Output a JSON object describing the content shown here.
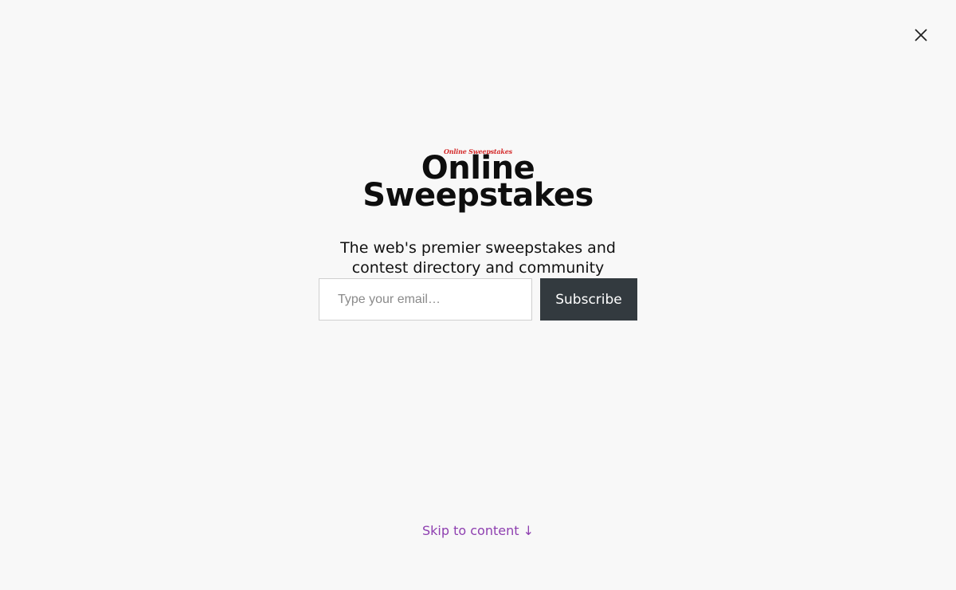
{
  "close": {
    "icon": "close-icon"
  },
  "logo": {
    "text": "Online Sweepstakes"
  },
  "title": {
    "line1": "Online",
    "line2": "Sweepstakes"
  },
  "tagline": {
    "line1": "The web's premier sweepstakes and",
    "line2": "contest directory and community"
  },
  "form": {
    "email_placeholder": "Type your email…",
    "email_value": "",
    "subscribe_label": "Subscribe"
  },
  "skip": {
    "label": "Skip to content ↓"
  },
  "colors": {
    "background": "#f8f8f8",
    "logo_red": "#d42a2a",
    "button_bg": "#333a3f",
    "link": "#8e3fb0"
  }
}
